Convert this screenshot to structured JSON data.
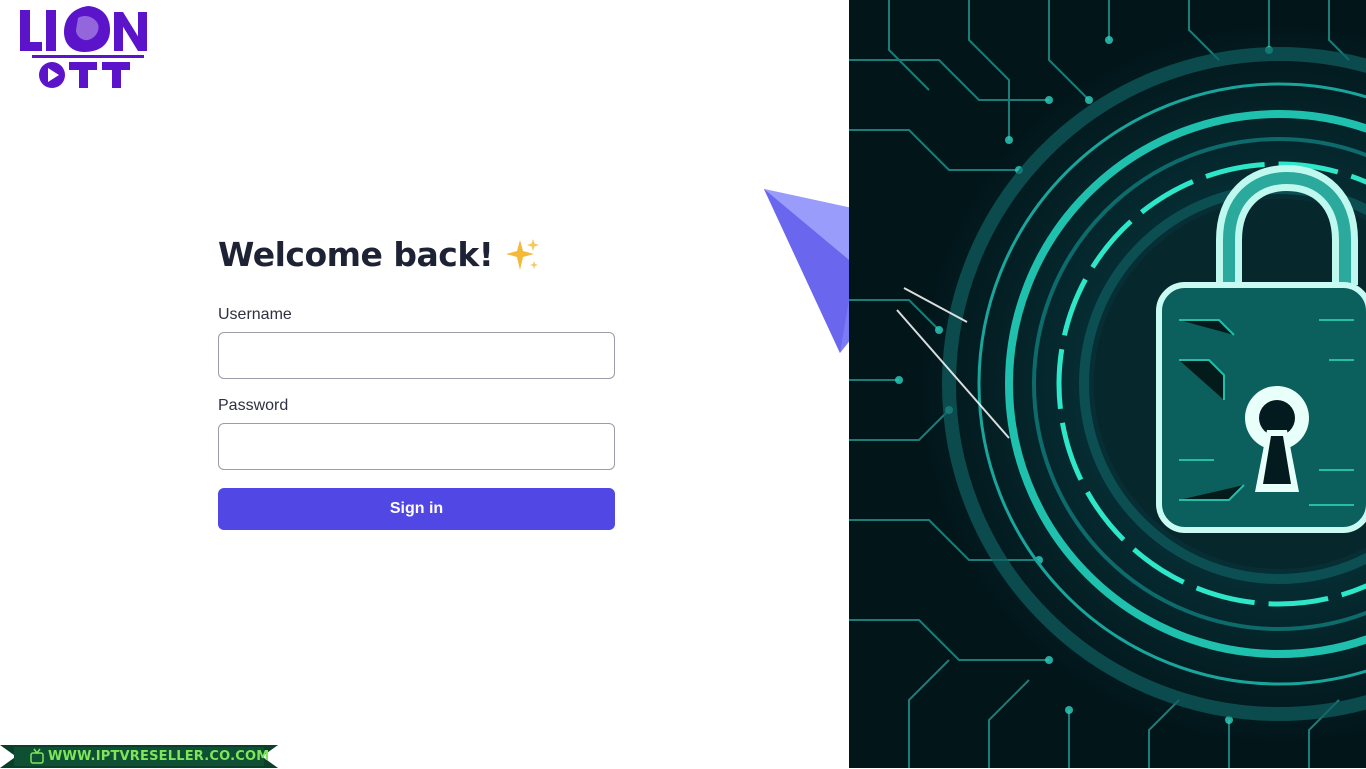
{
  "brand": {
    "logo_top": "LION",
    "logo_bottom": "OTT",
    "color": "#5b14c9"
  },
  "login": {
    "title": "Welcome back!",
    "title_icon": "sparkles-icon",
    "username_label": "Username",
    "username_value": "",
    "password_label": "Password",
    "password_value": "",
    "submit_label": "Sign in",
    "accent_color": "#5147e5"
  },
  "hero": {
    "image": "circuit-padlock-illustration",
    "icon": "padlock-icon",
    "accent_color": "#2ee6c8"
  },
  "footer": {
    "website": "WWW.IPTVRESELLER.CO.COM",
    "icon": "tv-icon"
  }
}
